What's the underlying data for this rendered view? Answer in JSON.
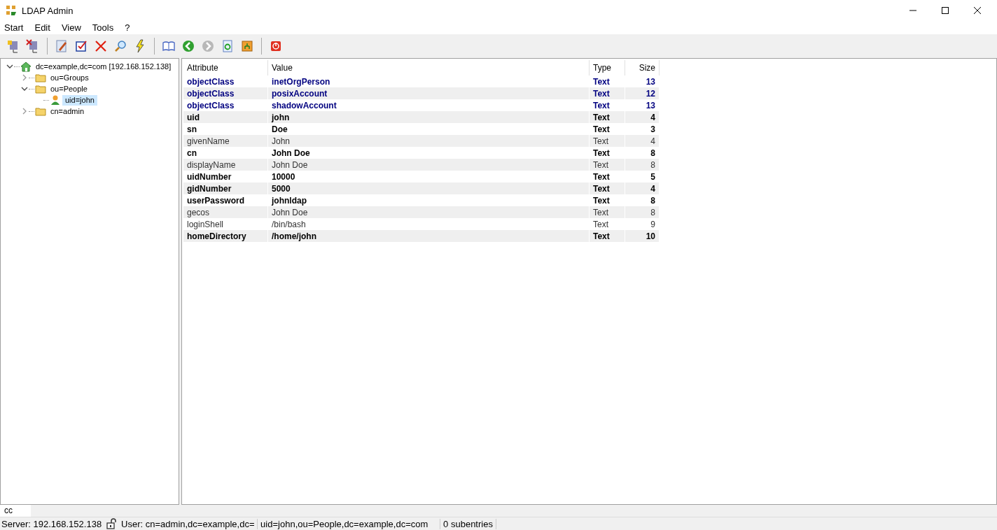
{
  "window": {
    "title": "LDAP Admin"
  },
  "menu": [
    "Start",
    "Edit",
    "View",
    "Tools",
    "?"
  ],
  "toolbar": {
    "forward_disabled": true
  },
  "tree": [
    {
      "label": "dc=example,dc=com [192.168.152.138]",
      "kind": "server",
      "expanded": true,
      "selected": false,
      "children": [
        {
          "label": "ou=Groups",
          "kind": "folder",
          "expanded": false,
          "selected": false
        },
        {
          "label": "ou=People",
          "kind": "folder",
          "expanded": true,
          "selected": false,
          "children": [
            {
              "label": "uid=john",
              "kind": "user",
              "selected": true
            }
          ]
        },
        {
          "label": "cn=admin",
          "kind": "folder",
          "expanded": false,
          "selected": false
        }
      ]
    }
  ],
  "table": {
    "columns": [
      "Attribute",
      "Value",
      "Type",
      "Size"
    ],
    "rows": [
      {
        "kind": "objectclass",
        "attribute": "objectClass",
        "value": "inetOrgPerson",
        "type": "Text",
        "size": "13"
      },
      {
        "kind": "objectclass",
        "attribute": "objectClass",
        "value": "posixAccount",
        "type": "Text",
        "size": "12"
      },
      {
        "kind": "objectclass",
        "attribute": "objectClass",
        "value": "shadowAccount",
        "type": "Text",
        "size": "13"
      },
      {
        "kind": "required",
        "attribute": "uid",
        "value": "john",
        "type": "Text",
        "size": "4"
      },
      {
        "kind": "required",
        "attribute": "sn",
        "value": "Doe",
        "type": "Text",
        "size": "3"
      },
      {
        "kind": "optional",
        "attribute": "givenName",
        "value": "John",
        "type": "Text",
        "size": "4"
      },
      {
        "kind": "required",
        "attribute": "cn",
        "value": "John Doe",
        "type": "Text",
        "size": "8"
      },
      {
        "kind": "optional",
        "attribute": "displayName",
        "value": "John Doe",
        "type": "Text",
        "size": "8"
      },
      {
        "kind": "required",
        "attribute": "uidNumber",
        "value": "10000",
        "type": "Text",
        "size": "5"
      },
      {
        "kind": "required",
        "attribute": "gidNumber",
        "value": "5000",
        "type": "Text",
        "size": "4"
      },
      {
        "kind": "required",
        "attribute": "userPassword",
        "value": "johnldap",
        "type": "Text",
        "size": "8"
      },
      {
        "kind": "optional",
        "attribute": "gecos",
        "value": "John Doe",
        "type": "Text",
        "size": "8"
      },
      {
        "kind": "optional",
        "attribute": "loginShell",
        "value": "/bin/bash",
        "type": "Text",
        "size": "9"
      },
      {
        "kind": "required",
        "attribute": "homeDirectory",
        "value": "/home/john",
        "type": "Text",
        "size": "10"
      }
    ]
  },
  "bottom_tabs": [
    {
      "label": "cc",
      "selected": true
    }
  ],
  "status_bar": {
    "server": "Server: 192.168.152.138",
    "user": "User: cn=admin,dc=example,dc=",
    "dn": "uid=john,ou=People,dc=example,dc=com",
    "subentries": "0 subentries"
  }
}
